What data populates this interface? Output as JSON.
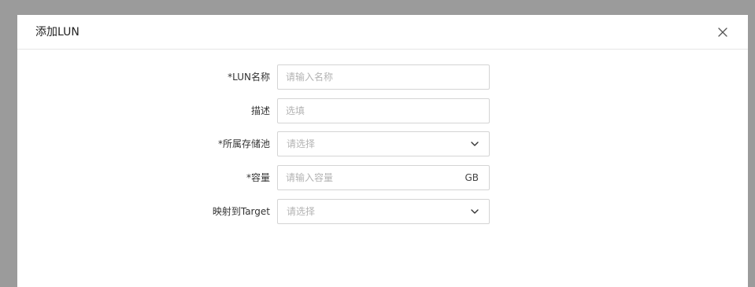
{
  "dialog": {
    "title": "添加LUN"
  },
  "form": {
    "lun_name": {
      "label": "*LUN名称",
      "placeholder": "请输入名称",
      "value": ""
    },
    "description": {
      "label": "描述",
      "placeholder": "选填",
      "value": ""
    },
    "pool": {
      "label": "*所属存储池",
      "selected": "请选择"
    },
    "capacity": {
      "label": "*容量",
      "placeholder": "请输入容量",
      "value": "",
      "unit": "GB"
    },
    "target": {
      "label": "映射到Target",
      "selected": "请选择"
    }
  },
  "icons": {
    "close": "close-icon",
    "dropdown": "chevron-down-icon"
  },
  "colors": {
    "overlay": "#9b9b9b",
    "dialog_bg": "#ffffff",
    "border": "#d4d4d4",
    "placeholder": "#b3b3b3"
  }
}
